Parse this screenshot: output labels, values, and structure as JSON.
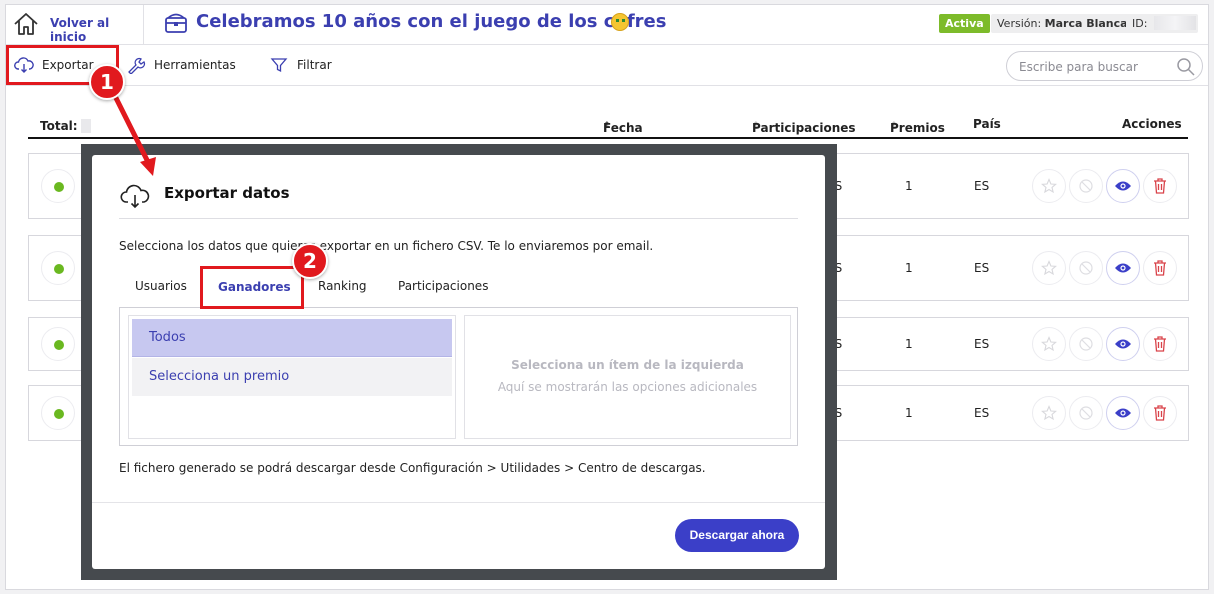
{
  "header": {
    "home_label": "Volver al inicio",
    "title": "Celebramos 10 años con el juego de los cofres",
    "status_badge": "Activa",
    "version_prefix": "Versión:",
    "version_value": "Marca Blanca",
    "id_label": "ID:"
  },
  "toolbar": {
    "export_label": "Exportar",
    "tools_label": "Herramientas",
    "filter_label": "Filtrar",
    "search_placeholder": "Escribe para buscar"
  },
  "table": {
    "total_label": "Total:",
    "col_fecha": "Fecha",
    "col_participaciones": "Participaciones",
    "col_premios": "Premios",
    "col_pais": "País",
    "col_acciones": "Acciones",
    "rows": [
      {
        "premios": "1",
        "pais": "ES",
        "part_fragment": "ES"
      },
      {
        "premios": "1",
        "pais": "ES",
        "part_fragment": "ES"
      },
      {
        "premios": "1",
        "pais": "ES",
        "part_fragment": "ES"
      },
      {
        "premios": "1",
        "pais": "ES",
        "part_fragment": "ES"
      }
    ]
  },
  "modal": {
    "title": "Exportar datos",
    "description": "Selecciona los datos que quieres exportar en un fichero CSV. Te lo enviaremos por email.",
    "tabs": [
      "Usuarios",
      "Ganadores",
      "Ranking",
      "Participaciones"
    ],
    "list_items": [
      "Todos",
      "Selecciona un premio"
    ],
    "detail_title": "Selecciona un ítem de la izquierda",
    "detail_subtitle": "Aquí se mostrarán las opciones adicionales",
    "note": "El fichero generado se podrá descargar desde Configuración > Utilidades > Centro de descargas.",
    "download_label": "Descargar ahora"
  },
  "callouts": [
    "1",
    "2"
  ],
  "colors": {
    "brand": "#3b3fb0",
    "active_badge": "#7dbb2a",
    "highlight": "#e1191e",
    "status_dot": "#6ab820"
  }
}
